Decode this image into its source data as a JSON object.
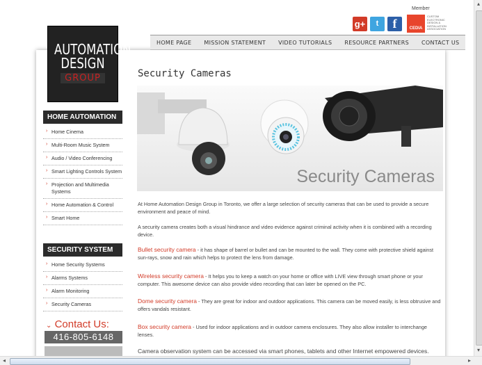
{
  "logo": {
    "line1": "AUTOMATION",
    "line2": "DESIGN",
    "line3": "GROUP"
  },
  "nav": [
    "HOME PAGE",
    "MISSION STATEMENT",
    "VIDEO TUTORIALS",
    "RESOURCE PARTNERS",
    "CONTACT US"
  ],
  "social": {
    "google": "g+",
    "twitter": "t",
    "facebook": "f"
  },
  "member": {
    "label": "Member",
    "cedia_badge": "CEDIA",
    "cedia_text": "CUSTOM ELECTRONIC DESIGN & INSTALLATION ASSOCIATION"
  },
  "sidebar": {
    "home_automation": {
      "title": "HOME AUTOMATION",
      "items": [
        "Home Cinema",
        "Multi-Room Music System",
        "Audio / Video Conferencing",
        "Smart Lighting Controls System",
        "Projection and Multimedia Systems",
        "Home Automation & Control",
        "Smart Home"
      ]
    },
    "security_system": {
      "title": "SECURITY SYSTEM",
      "items": [
        "Home Security Systems",
        "Alarms Systems",
        "Alarm Monitoring",
        "Security Cameras"
      ]
    },
    "contact": {
      "label": "Contact Us:",
      "phone": "416-805-6148"
    }
  },
  "main": {
    "title": "Security Cameras",
    "banner_text": "Security Cameras",
    "intro": "At Home Automation Design Group in Toronto, we offer a large selection of security cameras that can be used to provide a secure environment and peace of mind.",
    "para2": "A security camera creates both a visual hindrance and video evidence against criminal activity when it is combined with a recording device.",
    "items": [
      {
        "name": "Bullet security camera",
        "desc": " - it has shape of barrel or bullet and can be mounted to the wall. They come with protective shield against sun-rays, snow and rain which helps to protect the lens from damage."
      },
      {
        "name": "Wireless security camera",
        "desc": " - It helps you to keep a watch on your home or office with LIVE view through smart phone or your computer. This awesome device can also provide video recording that can later be opened on the PC."
      },
      {
        "name": "Dome security camera",
        "desc": " - They are great for indoor and outdoor applications. This camera can be moved easily, is less obtrusive and offers vandals resistant."
      },
      {
        "name": "Box security camera",
        "desc": " - Used for indoor applications and in outdoor camera enclosures. They also allow installer to interchange lenses."
      }
    ],
    "footer": "Camera observation system can be accessed via smart phones, tablets and other Internet empowered devices."
  },
  "colors": {
    "accent": "#d23b28",
    "sidebar_head": "#2b2b2b"
  }
}
